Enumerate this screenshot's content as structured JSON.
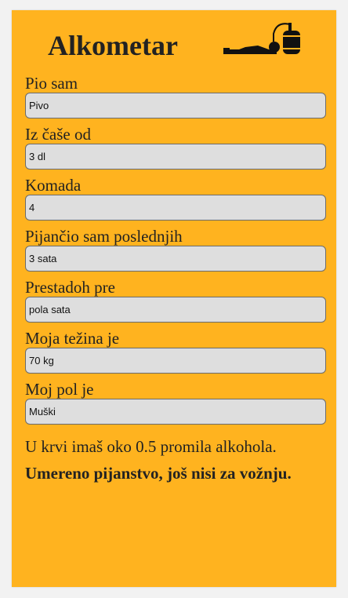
{
  "app": {
    "title": "Alkometar"
  },
  "form": {
    "fields": [
      {
        "label": "Pio sam",
        "value": "Pivo"
      },
      {
        "label": "Iz čaše od",
        "value": "3 dl"
      },
      {
        "label": "Komada",
        "value": "4"
      },
      {
        "label": "Pijančio sam poslednjih",
        "value": "3 sata"
      },
      {
        "label": "Prestadoh pre",
        "value": "pola sata"
      },
      {
        "label": "Moja težina je",
        "value": "70 kg"
      },
      {
        "label": "Moj pol je",
        "value": "Muški"
      }
    ]
  },
  "result": {
    "text": "U krvi imaš oko 0.5 promila alkohola.",
    "verdict": "Umereno pijanstvo, još nisi za vožnju."
  },
  "icons": {
    "logo": "drunk-person-with-barrel-icon"
  },
  "colors": {
    "background": "#ffb31f",
    "field": "#dedede",
    "text": "#222222"
  }
}
